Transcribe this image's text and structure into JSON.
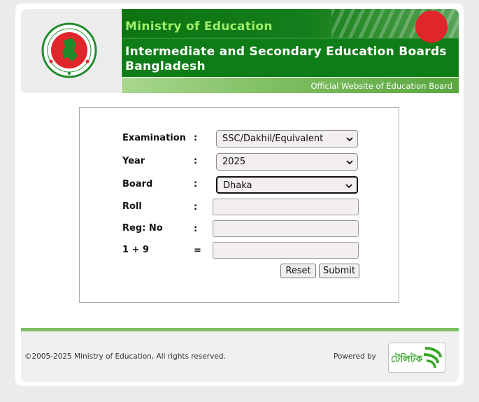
{
  "header": {
    "ministry": "Ministry of Education",
    "title_line1": "Intermediate and Secondary Education Boards",
    "title_line2": "Bangladesh",
    "official_site": "Official Website of Education Board",
    "logo_icon": "government-seal-icon"
  },
  "form": {
    "rows": [
      {
        "label": "Examination",
        "sep": ":",
        "value": "SSC/Dakhil/Equivalent"
      },
      {
        "label": "Year",
        "sep": ":",
        "value": "2025"
      },
      {
        "label": "Board",
        "sep": ":",
        "value": "Dhaka"
      },
      {
        "label": "Roll",
        "sep": ":",
        "value": ""
      },
      {
        "label": "Reg: No",
        "sep": ":",
        "value": ""
      },
      {
        "label": "1 + 9",
        "sep": "=",
        "value": ""
      }
    ],
    "reset_label": "Reset",
    "submit_label": "Submit"
  },
  "footer": {
    "copyright": "©2005-2025 Ministry of Education, All rights reserved.",
    "powered_by": "Powered by",
    "brand_logo": "teletalk-logo",
    "brand_text": "টেলিটক"
  },
  "colors": {
    "banner_green": "#0f7d17",
    "ministry_text": "#9fef68",
    "footer_line": "#7dbf64",
    "seal_red": "#e0262a"
  }
}
